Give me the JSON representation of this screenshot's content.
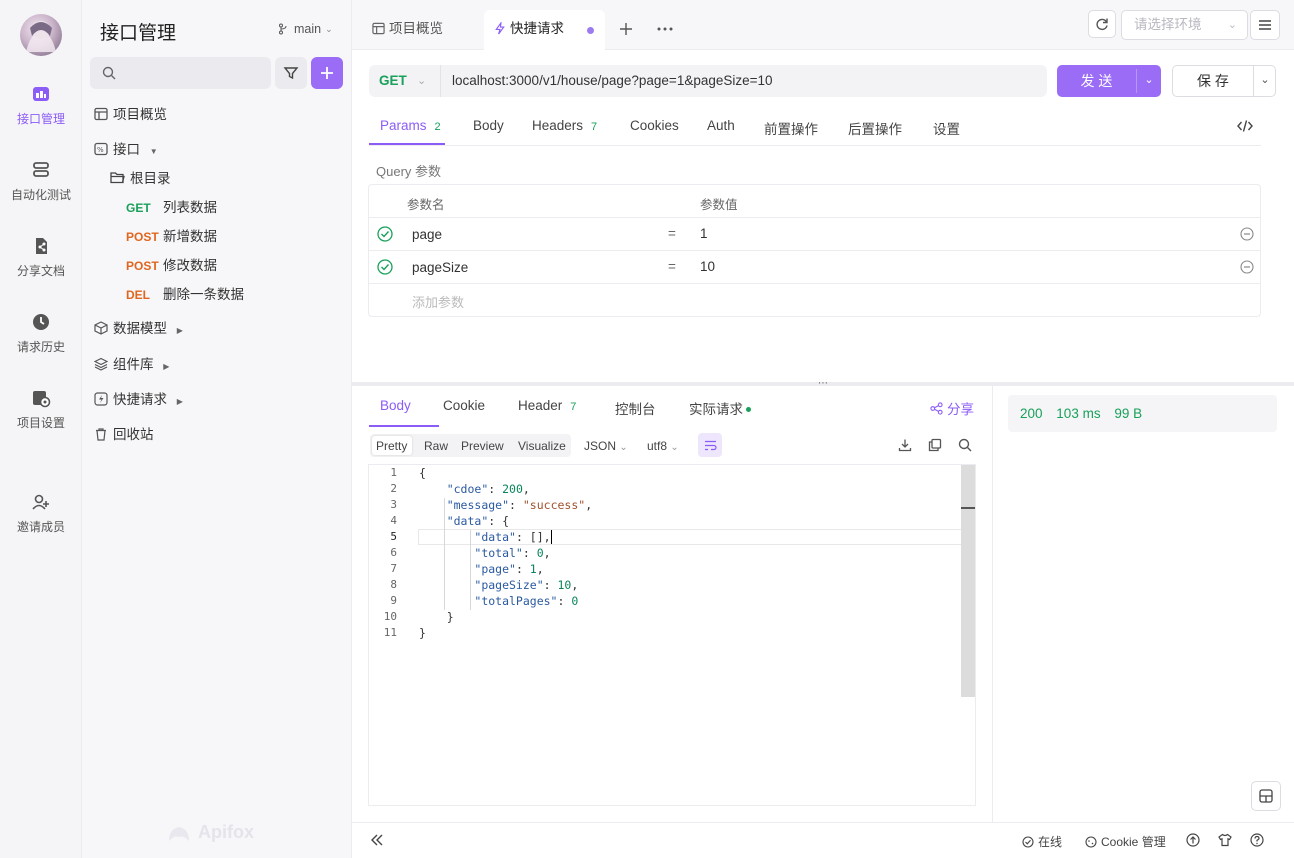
{
  "rail": {
    "items": [
      {
        "label": "接口管理",
        "icon": "api-management-icon"
      },
      {
        "label": "自动化测试",
        "icon": "automation-test-icon"
      },
      {
        "label": "分享文档",
        "icon": "share-doc-icon"
      },
      {
        "label": "请求历史",
        "icon": "history-icon"
      },
      {
        "label": "项目设置",
        "icon": "project-settings-icon"
      },
      {
        "label": "邀请成员",
        "icon": "invite-member-icon"
      }
    ]
  },
  "sidebar": {
    "title": "接口管理",
    "branch": "main",
    "search_placeholder": "",
    "items": {
      "overview": "项目概览",
      "api": "接口",
      "root": "根目录",
      "models": "数据模型",
      "components": "组件库",
      "quick": "快捷请求",
      "trash": "回收站"
    },
    "endpoints": [
      {
        "method": "GET",
        "name": "列表数据"
      },
      {
        "method": "POST",
        "name": "新增数据"
      },
      {
        "method": "POST",
        "name": "修改数据"
      },
      {
        "method": "DEL",
        "name": "删除一条数据"
      }
    ],
    "watermark": "Apifox"
  },
  "tabs": {
    "overview": "项目概览",
    "quick": "快捷请求",
    "env_placeholder": "请选择环境"
  },
  "request": {
    "method": "GET",
    "url": "localhost:3000/v1/house/page?page=1&pageSize=10",
    "send": "发 送",
    "save": "保 存"
  },
  "req_tabs": {
    "params": "Params",
    "params_count": "2",
    "body": "Body",
    "headers": "Headers",
    "headers_count": "7",
    "cookies": "Cookies",
    "auth": "Auth",
    "pre": "前置操作",
    "post": "后置操作",
    "settings": "设置"
  },
  "query": {
    "section": "Query 参数",
    "col_name": "参数名",
    "col_value": "参数值",
    "rows": [
      {
        "name": "page",
        "eq": "=",
        "value": "1"
      },
      {
        "name": "pageSize",
        "eq": "=",
        "value": "10"
      }
    ],
    "add_placeholder": "添加参数"
  },
  "resp_tabs": {
    "body": "Body",
    "cookie": "Cookie",
    "header": "Header",
    "header_count": "7",
    "console": "控制台",
    "actual": "实际请求",
    "share": "分享"
  },
  "view_modes": [
    "Pretty",
    "Raw",
    "Preview",
    "Visualize"
  ],
  "format": "JSON",
  "encoding": "utf8",
  "status": {
    "code": "200",
    "time": "103 ms",
    "size": "99 B"
  },
  "code": {
    "line_numbers": [
      "1",
      "2",
      "3",
      "4",
      "5",
      "6",
      "7",
      "8",
      "9",
      "10",
      "11"
    ]
  },
  "footer": {
    "online": "在线",
    "cookie_mgmt": "Cookie 管理"
  },
  "colors": {
    "accent": "#8b5cf6",
    "get": "#19a05a",
    "post": "#e0661e"
  }
}
